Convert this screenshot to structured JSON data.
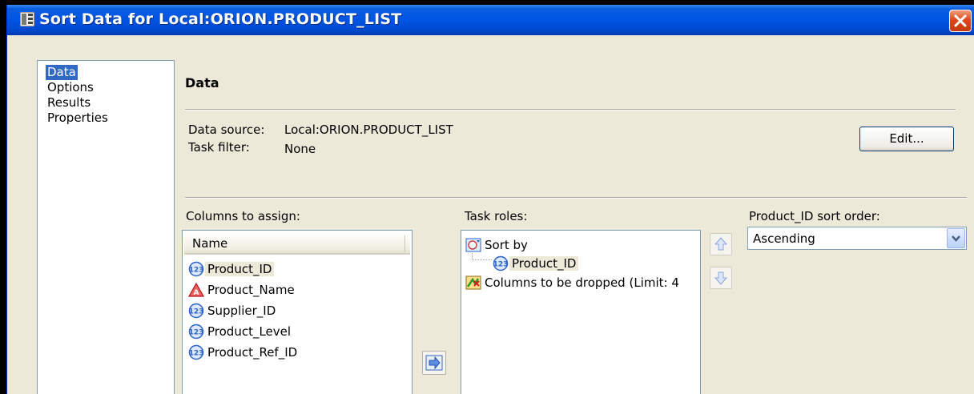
{
  "window": {
    "title": "Sort Data for Local:ORION.PRODUCT_LIST"
  },
  "nav": {
    "items": [
      {
        "label": "Data",
        "selected": true
      },
      {
        "label": "Options"
      },
      {
        "label": "Results"
      },
      {
        "label": "Properties"
      }
    ]
  },
  "section": {
    "title": "Data"
  },
  "source": {
    "data_source_label": "Data source:",
    "data_source_value": "Local:ORION.PRODUCT_LIST",
    "task_filter_label": "Task filter:",
    "task_filter_value": "None",
    "edit_button": "Edit..."
  },
  "columns": {
    "label": "Columns to assign:",
    "header": "Name",
    "items": [
      {
        "name": "Product_ID",
        "icon": "numeric-icon"
      },
      {
        "name": "Product_Name",
        "icon": "character-icon"
      },
      {
        "name": "Supplier_ID",
        "icon": "numeric-icon"
      },
      {
        "name": "Product_Level",
        "icon": "numeric-icon"
      },
      {
        "name": "Product_Ref_ID",
        "icon": "numeric-icon"
      }
    ]
  },
  "roles": {
    "label": "Task roles:",
    "sort_by": "Sort by",
    "sort_by_child": "Product_ID",
    "dropped": "Columns to be dropped  (Limit: 4"
  },
  "sort_order": {
    "label": "Product_ID sort order:",
    "value": "Ascending"
  },
  "colors": {
    "title_bar": "#0054e3",
    "selection": "#316ac5",
    "dialog_bg": "#ece9d8"
  }
}
